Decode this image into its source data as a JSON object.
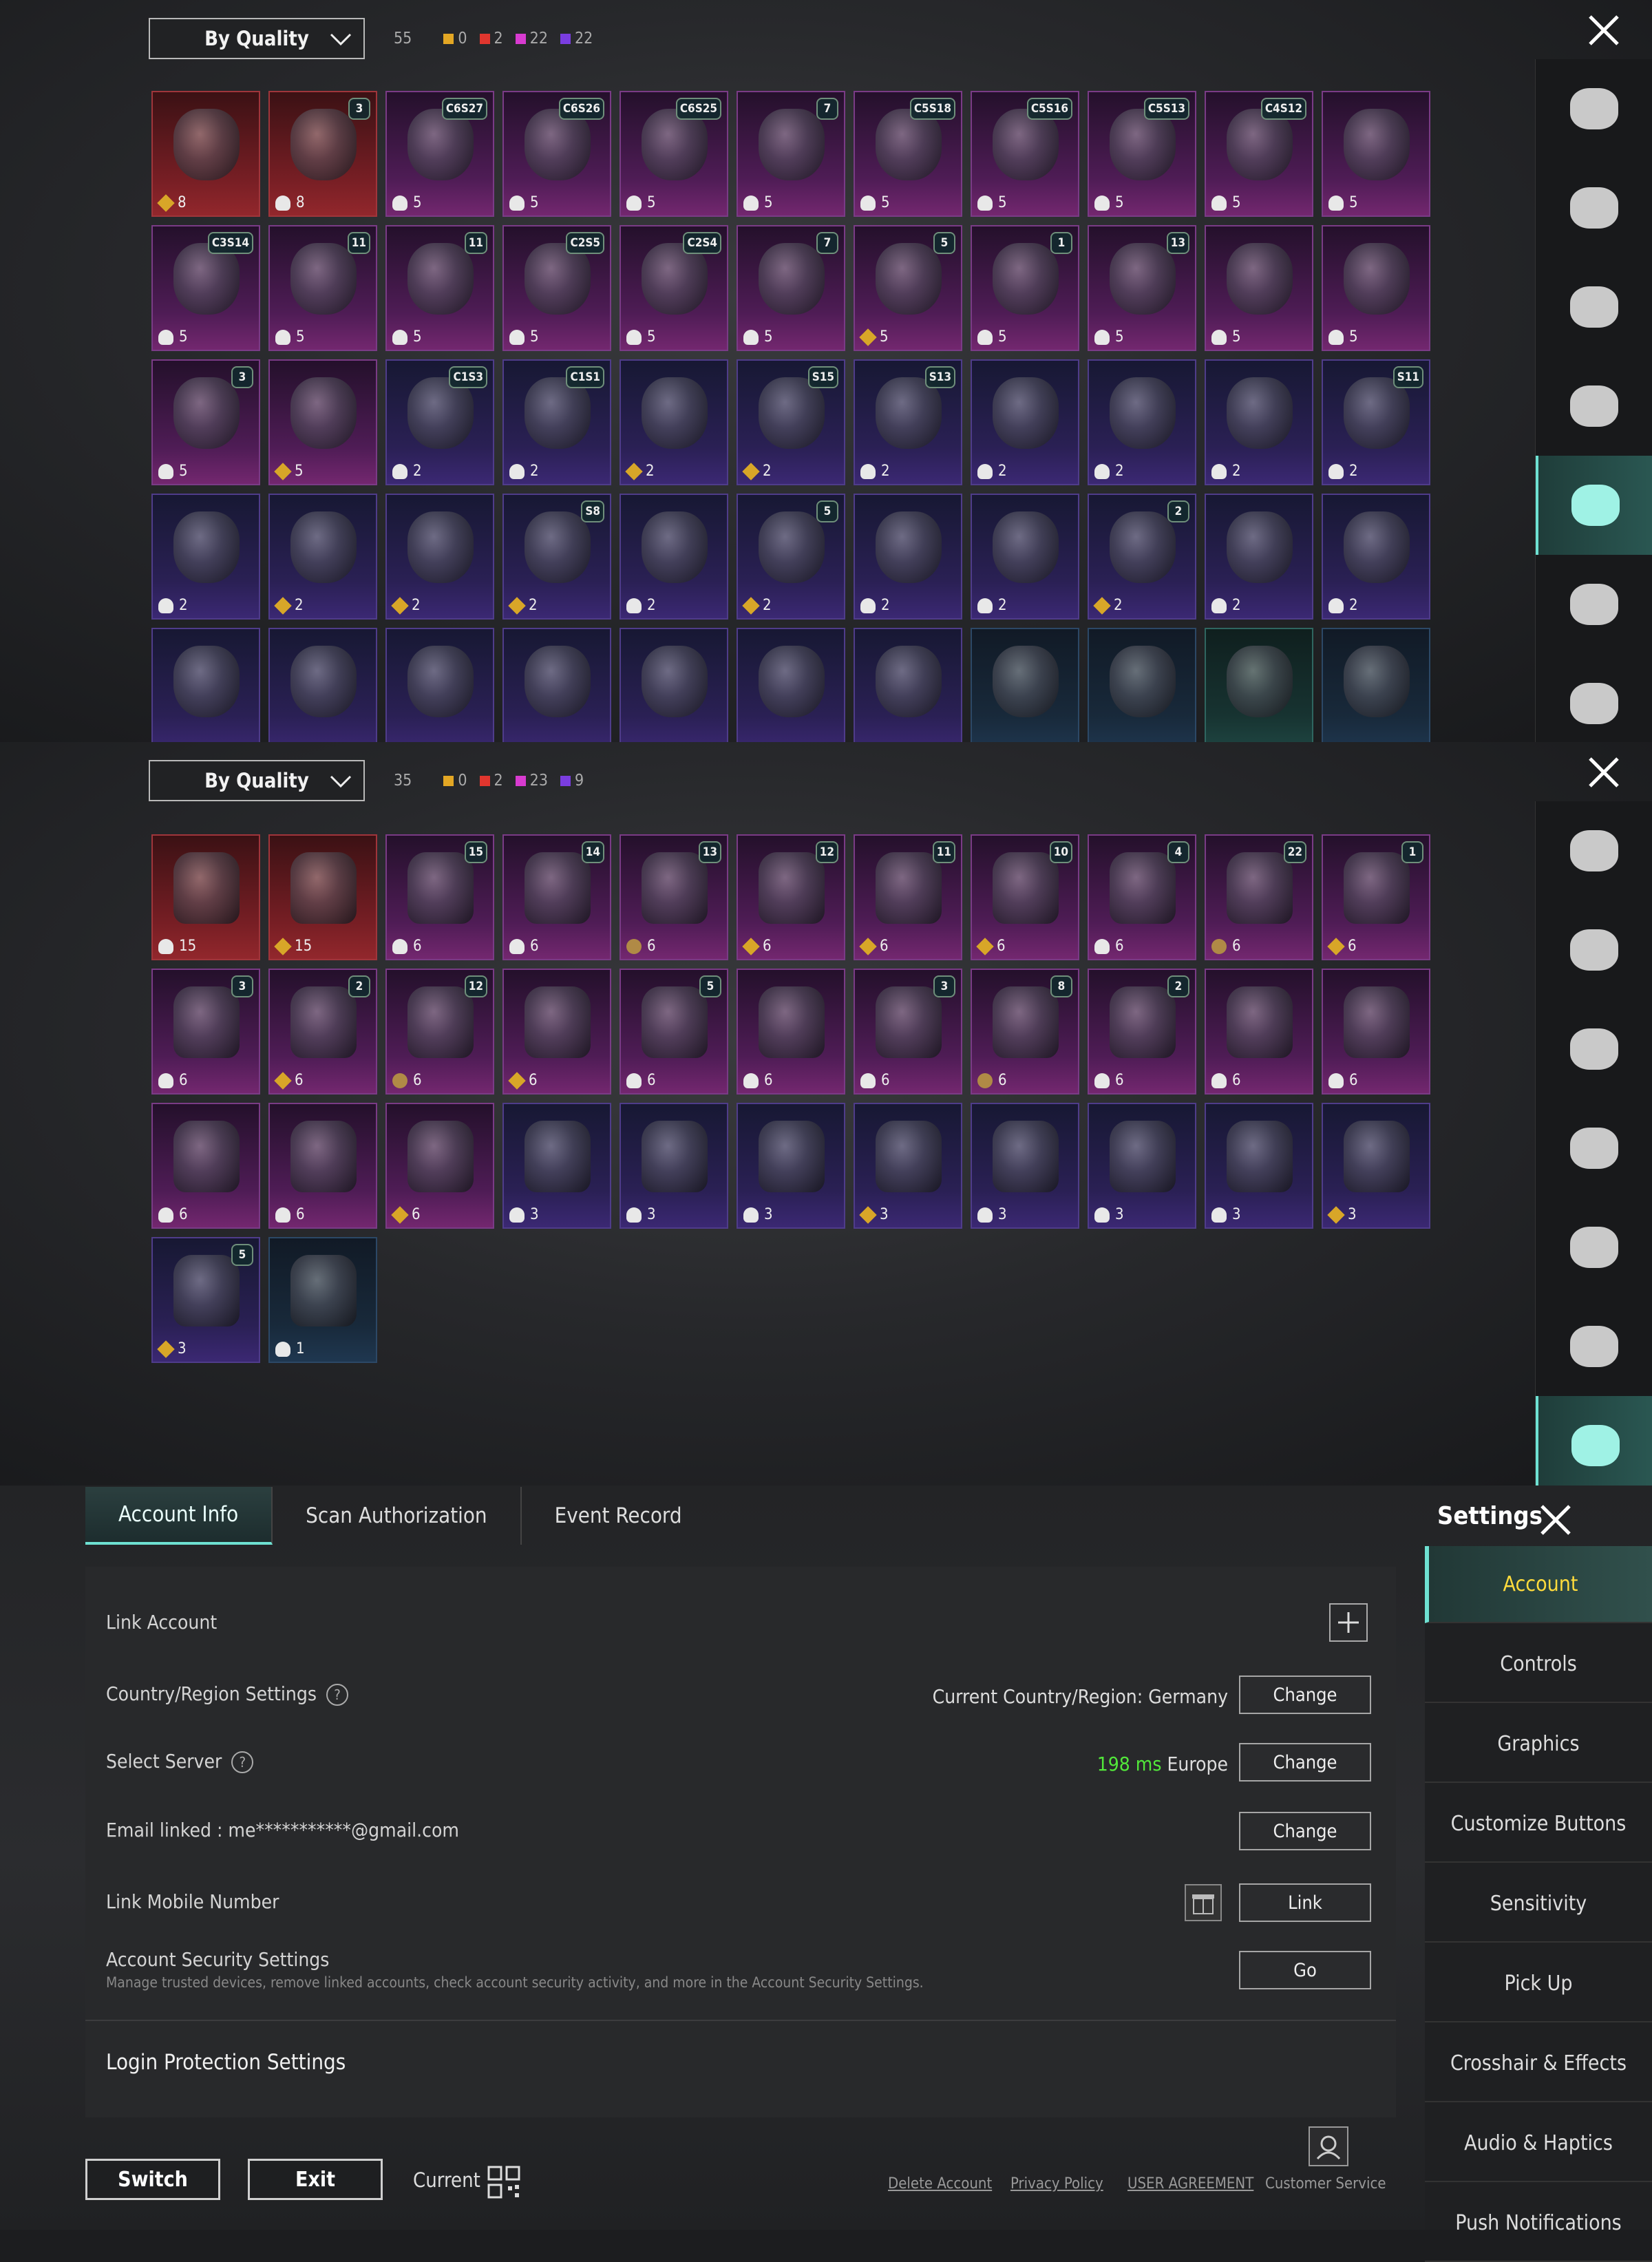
{
  "panel1": {
    "sort_label": "By Quality",
    "total": "55",
    "quality_counts": [
      {
        "color": "#e3a724",
        "value": "0"
      },
      {
        "color": "#e0362e",
        "value": "2"
      },
      {
        "color": "#d83bd0",
        "value": "22"
      },
      {
        "color": "#7a3de0",
        "value": "22"
      }
    ],
    "items": [
      {
        "q": "red",
        "badge": "",
        "stat": "8",
        "ic": "gold"
      },
      {
        "q": "red",
        "badge": "3",
        "stat": "8",
        "ic": "cloud"
      },
      {
        "q": "pink",
        "badge": "C6S27",
        "stat": "5",
        "ic": "cloud"
      },
      {
        "q": "pink",
        "badge": "C6S26",
        "stat": "5",
        "ic": "cloud"
      },
      {
        "q": "pink",
        "badge": "C6S25",
        "stat": "5",
        "ic": "cloud"
      },
      {
        "q": "pink",
        "badge": "7",
        "stat": "5",
        "ic": "cloud"
      },
      {
        "q": "pink",
        "badge": "C5S18",
        "stat": "5",
        "ic": "cloud"
      },
      {
        "q": "pink",
        "badge": "C5S16",
        "stat": "5",
        "ic": "cloud"
      },
      {
        "q": "pink",
        "badge": "C5S13",
        "stat": "5",
        "ic": "cloud"
      },
      {
        "q": "pink",
        "badge": "C4S12",
        "stat": "5",
        "ic": "cloud"
      },
      {
        "q": "pink",
        "badge": "",
        "stat": "5",
        "ic": "cloud"
      },
      {
        "q": "pink",
        "badge": "C3S14",
        "stat": "5",
        "ic": "cloud"
      },
      {
        "q": "pink",
        "badge": "11",
        "stat": "5",
        "ic": "cloud"
      },
      {
        "q": "pink",
        "badge": "11",
        "stat": "5",
        "ic": "cloud"
      },
      {
        "q": "pink",
        "badge": "C2S5",
        "stat": "5",
        "ic": "cloud"
      },
      {
        "q": "pink",
        "badge": "C2S4",
        "stat": "5",
        "ic": "cloud"
      },
      {
        "q": "pink",
        "badge": "7",
        "stat": "5",
        "ic": "cloud"
      },
      {
        "q": "pink",
        "badge": "5",
        "stat": "5",
        "ic": "gold"
      },
      {
        "q": "pink",
        "badge": "1",
        "stat": "5",
        "ic": "cloud"
      },
      {
        "q": "pink",
        "badge": "13",
        "stat": "5",
        "ic": "cloud"
      },
      {
        "q": "pink",
        "badge": "",
        "stat": "5",
        "ic": "cloud"
      },
      {
        "q": "pink",
        "badge": "",
        "stat": "5",
        "ic": "cloud"
      },
      {
        "q": "pink",
        "badge": "3",
        "stat": "5",
        "ic": "cloud"
      },
      {
        "q": "pink",
        "badge": "",
        "stat": "5",
        "ic": "gold"
      },
      {
        "q": "purple",
        "badge": "C1S3",
        "stat": "2",
        "ic": "cloud"
      },
      {
        "q": "purple",
        "badge": "C1S1",
        "stat": "2",
        "ic": "cloud"
      },
      {
        "q": "purple",
        "badge": "",
        "stat": "2",
        "ic": "gold"
      },
      {
        "q": "purple",
        "badge": "S15",
        "stat": "2",
        "ic": "gold"
      },
      {
        "q": "purple",
        "badge": "S13",
        "stat": "2",
        "ic": "cloud"
      },
      {
        "q": "purple",
        "badge": "",
        "stat": "2",
        "ic": "cloud"
      },
      {
        "q": "purple",
        "badge": "",
        "stat": "2",
        "ic": "cloud"
      },
      {
        "q": "purple",
        "badge": "",
        "stat": "2",
        "ic": "cloud"
      },
      {
        "q": "purple",
        "badge": "S11",
        "stat": "2",
        "ic": "cloud"
      },
      {
        "q": "purple",
        "badge": "",
        "stat": "2",
        "ic": "cloud"
      },
      {
        "q": "purple",
        "badge": "",
        "stat": "2",
        "ic": "gold"
      },
      {
        "q": "purple",
        "badge": "",
        "stat": "2",
        "ic": "gold"
      },
      {
        "q": "purple",
        "badge": "S8",
        "stat": "2",
        "ic": "gold"
      },
      {
        "q": "purple",
        "badge": "",
        "stat": "2",
        "ic": "cloud"
      },
      {
        "q": "purple",
        "badge": "5",
        "stat": "2",
        "ic": "gold"
      },
      {
        "q": "purple",
        "badge": "",
        "stat": "2",
        "ic": "cloud"
      },
      {
        "q": "purple",
        "badge": "",
        "stat": "2",
        "ic": "cloud"
      },
      {
        "q": "purple",
        "badge": "2",
        "stat": "2",
        "ic": "gold"
      },
      {
        "q": "purple",
        "badge": "",
        "stat": "2",
        "ic": "cloud"
      },
      {
        "q": "purple",
        "badge": "",
        "stat": "2",
        "ic": "cloud"
      },
      {
        "q": "purple",
        "badge": "",
        "stat": "",
        "ic": ""
      },
      {
        "q": "purple",
        "badge": "",
        "stat": "",
        "ic": ""
      },
      {
        "q": "purple",
        "badge": "",
        "stat": "",
        "ic": ""
      },
      {
        "q": "purple",
        "badge": "",
        "stat": "",
        "ic": ""
      },
      {
        "q": "purple",
        "badge": "",
        "stat": "",
        "ic": ""
      },
      {
        "q": "purple",
        "badge": "",
        "stat": "",
        "ic": ""
      },
      {
        "q": "purple",
        "badge": "",
        "stat": "",
        "ic": ""
      },
      {
        "q": "blue",
        "badge": "",
        "stat": "",
        "ic": ""
      },
      {
        "q": "blue",
        "badge": "",
        "stat": "",
        "ic": ""
      },
      {
        "q": "teal",
        "badge": "",
        "stat": "",
        "ic": ""
      },
      {
        "q": "blue",
        "badge": "",
        "stat": "",
        "ic": ""
      }
    ],
    "sidebar_icons": [
      "shirt-icon",
      "helmet-icon",
      "cap-icon",
      "glasses-icon",
      "mask-icon",
      "jacket-icon",
      "backpack-icon"
    ],
    "active_sidebar": 4
  },
  "panel2": {
    "sort_label": "By Quality",
    "total": "35",
    "quality_counts": [
      {
        "color": "#e3a724",
        "value": "0"
      },
      {
        "color": "#e0362e",
        "value": "2"
      },
      {
        "color": "#d83bd0",
        "value": "23"
      },
      {
        "color": "#7a3de0",
        "value": "9"
      }
    ],
    "items": [
      {
        "q": "red",
        "badge": "",
        "stat": "15",
        "ic": "cloud"
      },
      {
        "q": "red",
        "badge": "",
        "stat": "15",
        "ic": "gold"
      },
      {
        "q": "pink",
        "badge": "15",
        "stat": "6",
        "ic": "cloud"
      },
      {
        "q": "pink",
        "badge": "14",
        "stat": "6",
        "ic": "cloud"
      },
      {
        "q": "pink",
        "badge": "13",
        "stat": "6",
        "ic": "coin"
      },
      {
        "q": "pink",
        "badge": "12",
        "stat": "6",
        "ic": "gold"
      },
      {
        "q": "pink",
        "badge": "11",
        "stat": "6",
        "ic": "gold"
      },
      {
        "q": "pink",
        "badge": "10",
        "stat": "6",
        "ic": "gold"
      },
      {
        "q": "pink",
        "badge": "4",
        "stat": "6",
        "ic": "cloud"
      },
      {
        "q": "pink",
        "badge": "22",
        "stat": "6",
        "ic": "coin"
      },
      {
        "q": "pink",
        "badge": "1",
        "stat": "6",
        "ic": "gold"
      },
      {
        "q": "pink",
        "badge": "3",
        "stat": "6",
        "ic": "cloud"
      },
      {
        "q": "pink",
        "badge": "2",
        "stat": "6",
        "ic": "gold"
      },
      {
        "q": "pink",
        "badge": "12",
        "stat": "6",
        "ic": "coin"
      },
      {
        "q": "pink",
        "badge": "",
        "stat": "6",
        "ic": "gold"
      },
      {
        "q": "pink",
        "badge": "5",
        "stat": "6",
        "ic": "cloud"
      },
      {
        "q": "pink",
        "badge": "",
        "stat": "6",
        "ic": "cloud"
      },
      {
        "q": "pink",
        "badge": "3",
        "stat": "6",
        "ic": "cloud"
      },
      {
        "q": "pink",
        "badge": "8",
        "stat": "6",
        "ic": "coin"
      },
      {
        "q": "pink",
        "badge": "2",
        "stat": "6",
        "ic": "cloud"
      },
      {
        "q": "pink",
        "badge": "",
        "stat": "6",
        "ic": "cloud"
      },
      {
        "q": "pink",
        "badge": "",
        "stat": "6",
        "ic": "cloud"
      },
      {
        "q": "pink",
        "badge": "",
        "stat": "6",
        "ic": "cloud"
      },
      {
        "q": "pink",
        "badge": "",
        "stat": "6",
        "ic": "cloud"
      },
      {
        "q": "pink",
        "badge": "",
        "stat": "6",
        "ic": "gold"
      },
      {
        "q": "purple",
        "badge": "",
        "stat": "3",
        "ic": "cloud"
      },
      {
        "q": "purple",
        "badge": "",
        "stat": "3",
        "ic": "cloud"
      },
      {
        "q": "purple",
        "badge": "",
        "stat": "3",
        "ic": "cloud"
      },
      {
        "q": "purple",
        "badge": "",
        "stat": "3",
        "ic": "gold"
      },
      {
        "q": "purple",
        "badge": "",
        "stat": "3",
        "ic": "cloud"
      },
      {
        "q": "purple",
        "badge": "",
        "stat": "3",
        "ic": "cloud"
      },
      {
        "q": "purple",
        "badge": "",
        "stat": "3",
        "ic": "cloud"
      },
      {
        "q": "purple",
        "badge": "",
        "stat": "3",
        "ic": "gold"
      },
      {
        "q": "purple",
        "badge": "5",
        "stat": "3",
        "ic": "gold"
      },
      {
        "q": "blue",
        "badge": "",
        "stat": "1",
        "ic": "cloud"
      }
    ],
    "sidebar_icons": [
      "shirt-icon",
      "helmet-icon",
      "cap-icon",
      "glasses-icon",
      "mask-icon",
      "jacket-icon",
      "backpack-icon"
    ],
    "active_sidebar": 6
  },
  "settings": {
    "tabs": [
      "Account Info",
      "Scan Authorization",
      "Event Record"
    ],
    "title": "Settings",
    "link_account": "Link Account",
    "country_label": "Country/Region Settings",
    "country_value": "Current Country/Region: Germany",
    "server_label": "Select Server",
    "server_ping": "198 ms",
    "server_region": "Europe",
    "email_label": "Email linked : me***********@gmail.com",
    "mobile_label": "Link Mobile Number",
    "security_label": "Account Security Settings",
    "security_desc": "Manage trusted devices, remove linked accounts, check account security activity, and more in the Account Security Settings.",
    "login_protection": "Login Protection Settings",
    "change": "Change",
    "link": "Link",
    "go": "Go",
    "nav": [
      "Account",
      "Controls",
      "Graphics",
      "Customize Buttons",
      "Sensitivity",
      "Pick Up",
      "Crosshair & Effects",
      "Audio & Haptics",
      "Push Notifications"
    ],
    "switch": "Switch",
    "exit": "Exit",
    "current": "Current",
    "footer_links": [
      "Delete Account",
      "Privacy Policy",
      "USER AGREEMENT",
      "Customer Service"
    ]
  }
}
